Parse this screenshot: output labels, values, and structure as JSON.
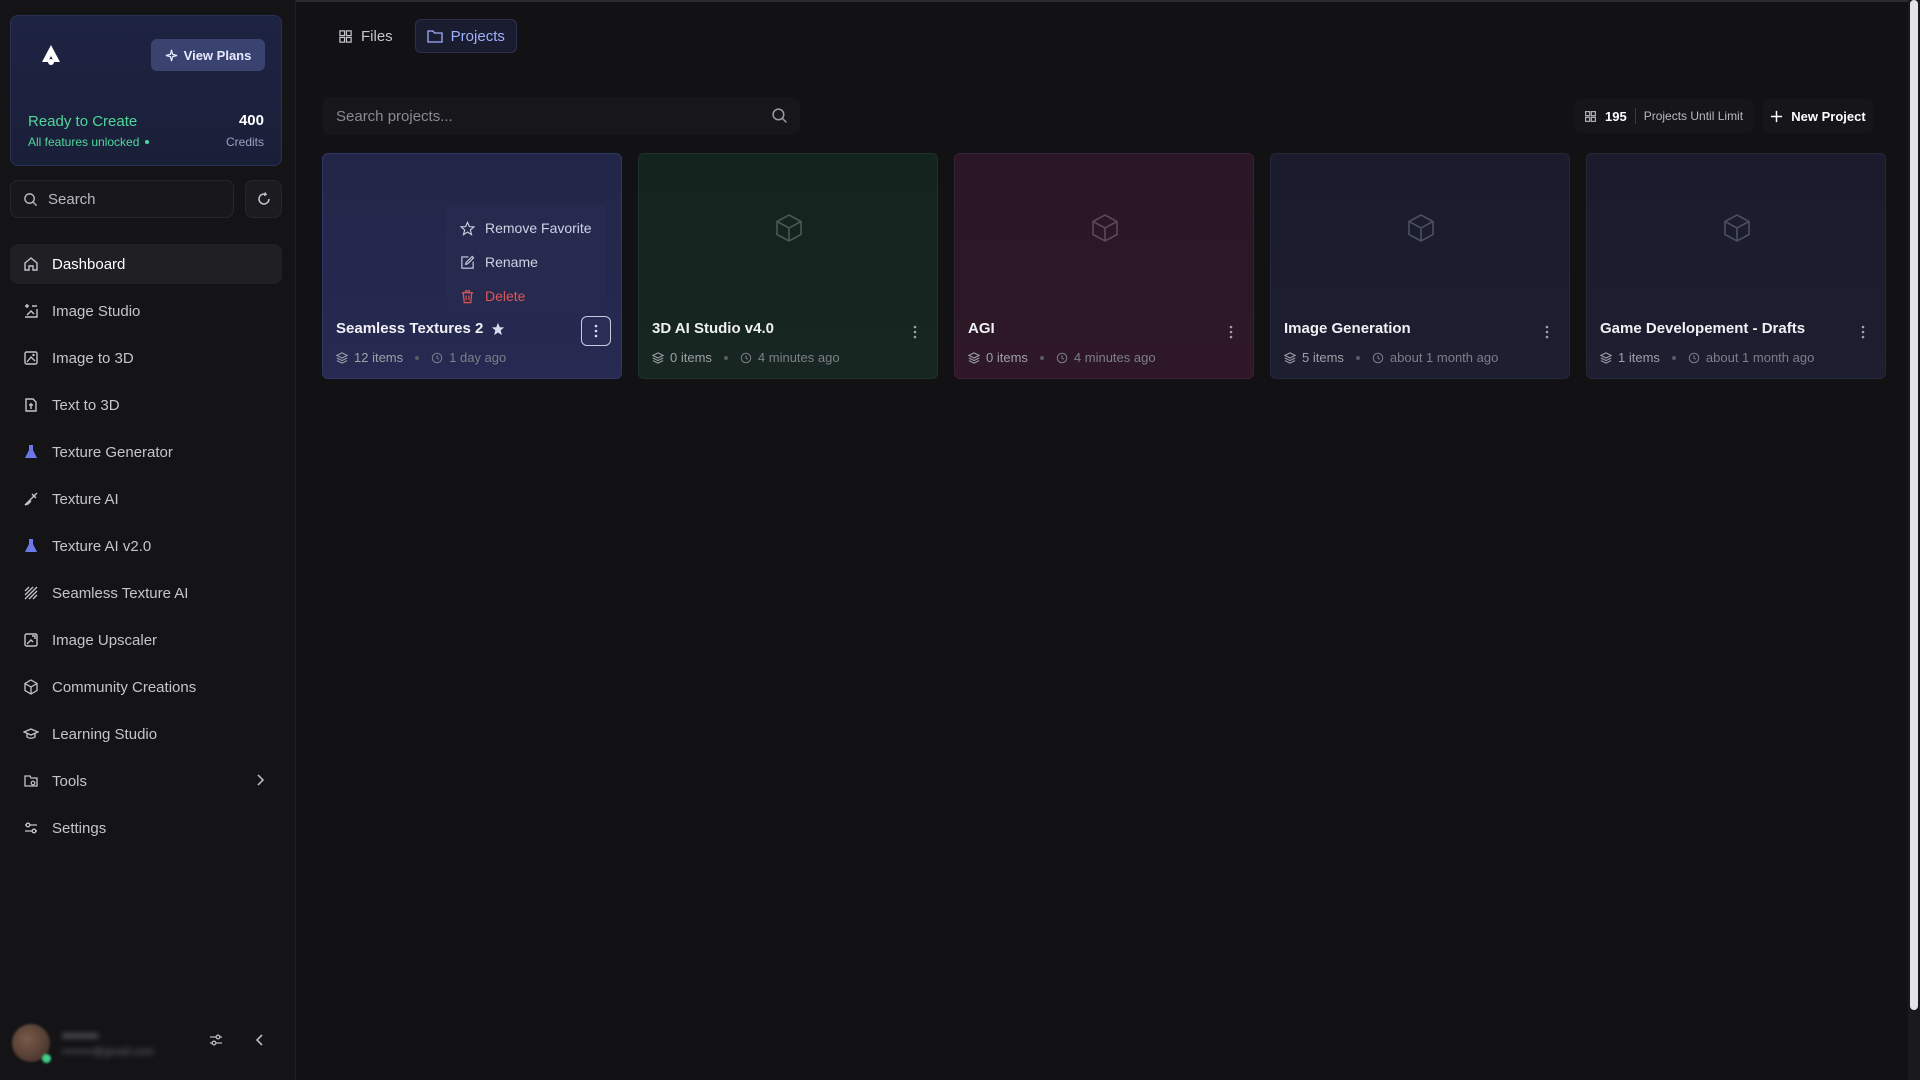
{
  "brand": {
    "view_plans_label": "View Plans",
    "status_title": "Ready to Create",
    "status_sub": "All features unlocked",
    "credits_value": "400",
    "credits_label": "Credits"
  },
  "sidebar": {
    "search_placeholder": "Search",
    "items": [
      {
        "label": "Dashboard",
        "icon": "home-icon",
        "active": true
      },
      {
        "label": "Image Studio",
        "icon": "image-studio-icon"
      },
      {
        "label": "Image to 3D",
        "icon": "image-to-3d-icon"
      },
      {
        "label": "Text to 3D",
        "icon": "text-to-3d-icon"
      },
      {
        "label": "Texture Generator",
        "icon": "flask-icon"
      },
      {
        "label": "Texture AI",
        "icon": "brush-icon"
      },
      {
        "label": "Texture AI v2.0",
        "icon": "flask-icon"
      },
      {
        "label": "Seamless Texture AI",
        "icon": "hatch-icon"
      },
      {
        "label": "Image Upscaler",
        "icon": "upscale-icon"
      },
      {
        "label": "Community Creations",
        "icon": "cube-icon"
      },
      {
        "label": "Learning Studio",
        "icon": "graduation-cap-icon"
      },
      {
        "label": "Tools",
        "icon": "tools-icon",
        "has_submenu": true
      },
      {
        "label": "Settings",
        "icon": "sliders-icon"
      }
    ],
    "user": {
      "name": "••••••••",
      "email": "••••••••@gmail.com"
    }
  },
  "tabs": [
    {
      "label": "Files",
      "icon": "grid-icon",
      "active": false
    },
    {
      "label": "Projects",
      "icon": "folder-icon",
      "active": true
    }
  ],
  "projects_search_placeholder": "Search projects...",
  "limit": {
    "value": "195",
    "label": "Projects Until Limit"
  },
  "new_project_label": "New Project",
  "projects": [
    {
      "title": "Seamless Textures 2",
      "favorite": true,
      "items": "12 items",
      "time": "1 day ago",
      "color": "#252a50"
    },
    {
      "title": "3D AI Studio v4.0",
      "favorite": false,
      "items": "0 items",
      "time": "4 minutes ago",
      "color": "#152520"
    },
    {
      "title": "AGI",
      "favorite": false,
      "items": "0 items",
      "time": "4 minutes ago",
      "color": "#2c1727"
    },
    {
      "title": "Image Generation",
      "favorite": false,
      "items": "5 items",
      "time": "about 1 month ago",
      "color": "#1c1d2f"
    },
    {
      "title": "Game Developement - Drafts",
      "favorite": false,
      "items": "1 items",
      "time": "about 1 month ago",
      "color": "#1c1d2f"
    }
  ],
  "context_menu": {
    "remove_favorite": "Remove Favorite",
    "rename": "Rename",
    "delete": "Delete"
  },
  "colors": {
    "accent": "#9fb0ff",
    "status_green": "#4fd69a",
    "danger": "#e05555"
  }
}
